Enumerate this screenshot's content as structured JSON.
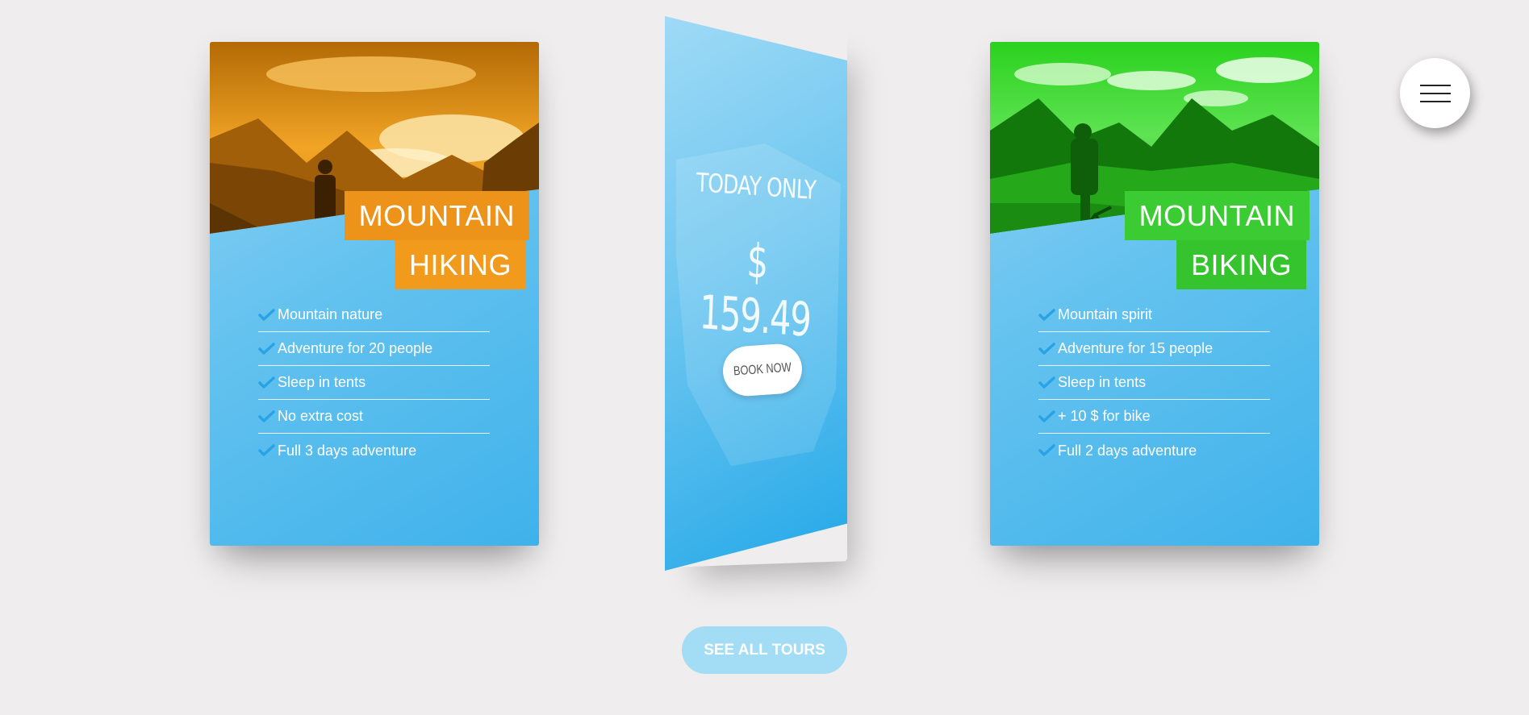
{
  "cards": {
    "hiking": {
      "title_line1": "MOUNTAIN",
      "title_line2": "HIKING",
      "features": [
        "Mountain nature",
        "Adventure for 20 people",
        "Sleep in tents",
        "No extra cost",
        "Full 3 days adventure"
      ],
      "accent_color": "#f19a1c"
    },
    "biking": {
      "title_line1": "MOUNTAIN",
      "title_line2": "BIKING",
      "features": [
        "Mountain spirit",
        "Adventure for 15 people",
        "Sleep in tents",
        "+ 10 $ for bike",
        "Full 2 days adventure"
      ],
      "accent_color": "#35c42e"
    }
  },
  "promo": {
    "label": "TODAY ONLY",
    "price": "$ 159.49",
    "button_label": "BOOK NOW"
  },
  "see_all_label": "SEE ALL TOURS",
  "menu": {
    "icon": "hamburger-menu-icon"
  },
  "colors": {
    "background": "#efeded",
    "card_blue": "#64c2ef",
    "checkmark": "#2aa3e6"
  }
}
